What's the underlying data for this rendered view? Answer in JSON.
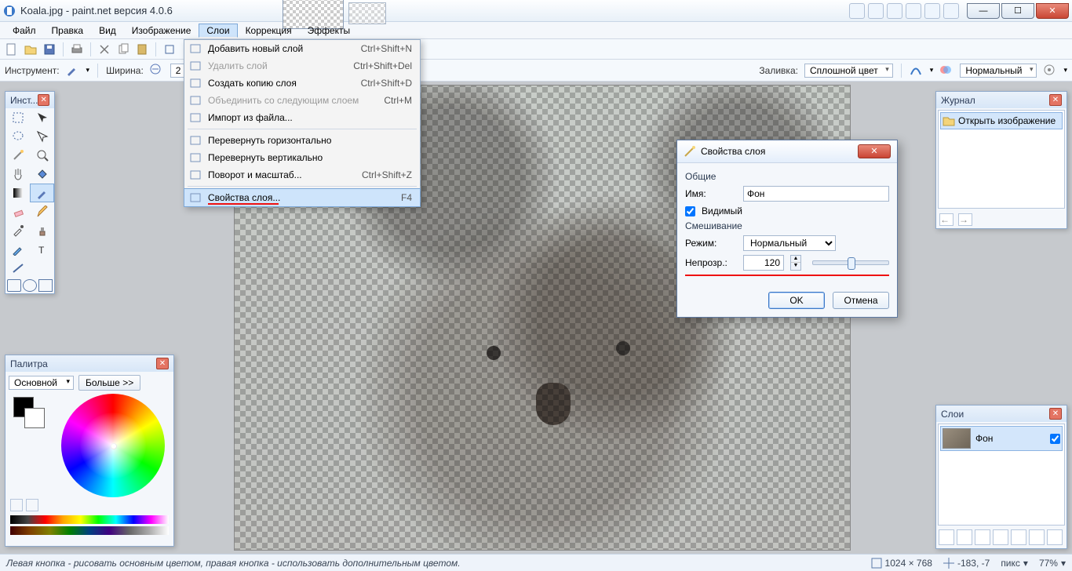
{
  "title": "Koala.jpg - paint.net версия 4.0.6",
  "menus": [
    "Файл",
    "Правка",
    "Вид",
    "Изображение",
    "Слои",
    "Коррекция",
    "Эффекты"
  ],
  "open_menu_index": 4,
  "layers_menu": [
    {
      "label": "Добавить новый слой",
      "shortcut": "Ctrl+Shift+N",
      "enabled": true
    },
    {
      "label": "Удалить слой",
      "shortcut": "Ctrl+Shift+Del",
      "enabled": false
    },
    {
      "label": "Создать копию слоя",
      "shortcut": "Ctrl+Shift+D",
      "enabled": true
    },
    {
      "label": "Объединить со следующим слоем",
      "shortcut": "Ctrl+M",
      "enabled": false
    },
    {
      "label": "Импорт из файла...",
      "shortcut": "",
      "enabled": true
    },
    {
      "sep": true
    },
    {
      "label": "Перевернуть горизонтально",
      "shortcut": "",
      "enabled": true
    },
    {
      "label": "Перевернуть вертикально",
      "shortcut": "",
      "enabled": true
    },
    {
      "label": "Поворот и масштаб...",
      "shortcut": "Ctrl+Shift+Z",
      "enabled": true
    },
    {
      "sep": true
    },
    {
      "label": "Свойства слоя...",
      "shortcut": "F4",
      "enabled": true,
      "selected": true
    }
  ],
  "toolbar2": {
    "tool_label": "Инструмент:",
    "width_label": "Ширина:",
    "width_value": "2",
    "fill_label": "Сплошной цвет",
    "blend_label": "Нормальный"
  },
  "tools_panel": {
    "title": "Инст..."
  },
  "history_panel": {
    "title": "Журнал",
    "item": "Открыть изображение"
  },
  "layers_panel": {
    "title": "Слои",
    "layer_name": "Фон",
    "visible": true
  },
  "palette_panel": {
    "title": "Палитра",
    "mode": "Основной",
    "more": "Больше >>"
  },
  "layer_props": {
    "title": "Свойства слоя",
    "group_general": "Общие",
    "name_label": "Имя:",
    "name_value": "Фон",
    "visible_label": "Видимый",
    "visible_checked": true,
    "group_blend": "Смешивание",
    "mode_label": "Режим:",
    "mode_value": "Нормальный",
    "opacity_label": "Непрозр.:",
    "opacity_value": "120",
    "ok": "OK",
    "cancel": "Отмена"
  },
  "status": {
    "hint": "Левая кнопка - рисовать основным цветом, правая кнопка - использовать дополнительным цветом.",
    "dims": "1024 × 768",
    "cursor": "-183, -7",
    "units": "пикс",
    "zoom": "77%"
  }
}
